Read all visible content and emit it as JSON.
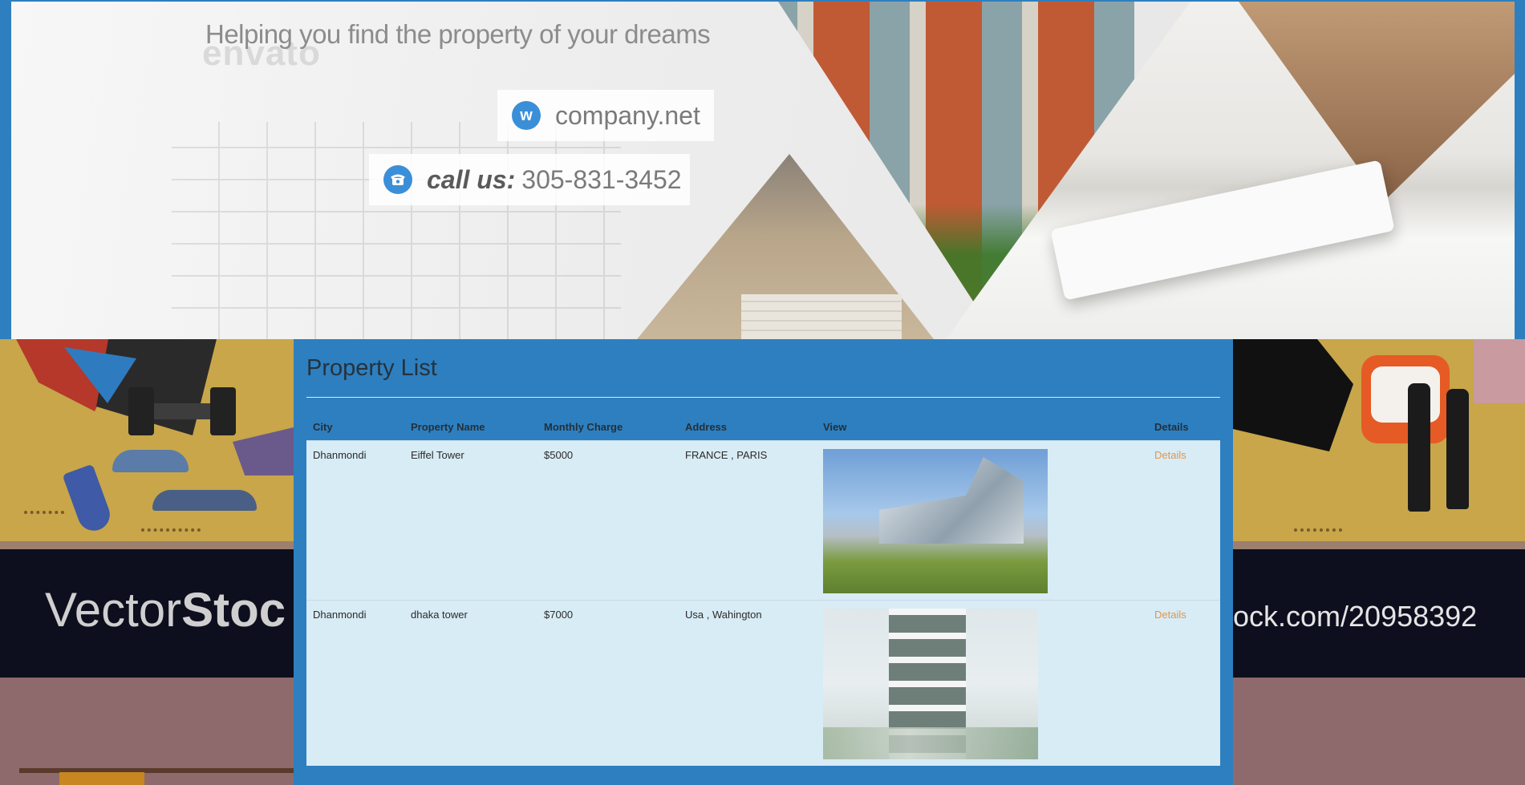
{
  "banner": {
    "tagline": "Helping you find the property of your dreams",
    "watermark": "envato",
    "website_icon_letter": "w",
    "website": "company.net",
    "call_prefix": "call us:",
    "phone": "305-831-3452"
  },
  "background": {
    "left_text_regular": "Vector",
    "left_text_bold": "Stoc",
    "right_text": "ock.com/20958392"
  },
  "property_list": {
    "title": "Property List",
    "columns": [
      "City",
      "Property Name",
      "Monthly Charge",
      "Address",
      "View",
      "Details"
    ],
    "rows": [
      {
        "city": "Dhanmondi",
        "name": "Eiffel Tower",
        "charge": "$5000",
        "address": "FRANCE , PARIS",
        "details": "Details"
      },
      {
        "city": "Dhanmondi",
        "name": "dhaka tower",
        "charge": "$7000",
        "address": "Usa , Wahington",
        "details": "Details"
      }
    ]
  },
  "colors": {
    "page_blue": "#2e7fbf",
    "row_bg": "#d8ecf6",
    "link_orange": "#e1964a"
  }
}
